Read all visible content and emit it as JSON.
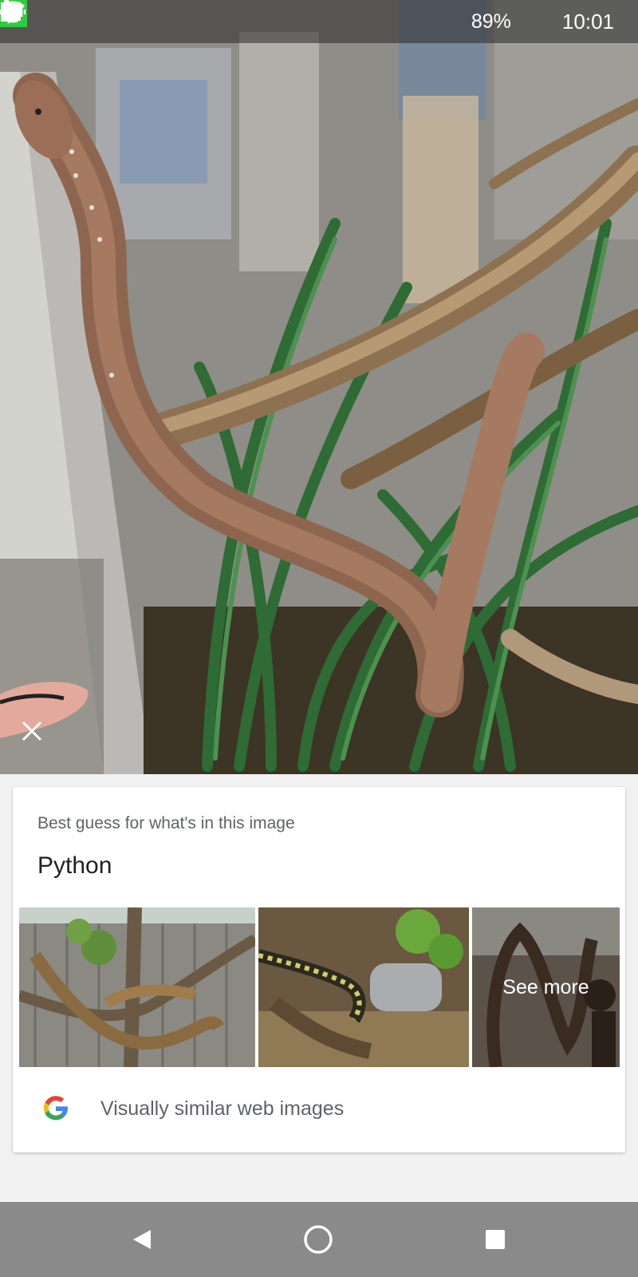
{
  "status_bar": {
    "battery_percent": "89%",
    "time": "10:01",
    "notification_icons": [
      "audio-wave-icon",
      "amazon-icon",
      "gmail-icon",
      "gallery-icon",
      "phone-app-icon"
    ],
    "system_icons": [
      "data-saver-icon",
      "bluetooth-icon",
      "vibrate-icon",
      "alarm-icon",
      "wifi-icon",
      "cell-signal-icon",
      "battery-icon"
    ]
  },
  "close_icon": "close-icon",
  "result_card": {
    "subtitle": "Best guess for what's in this image",
    "title": "Python",
    "thumbnails": [
      {
        "name": "python-in-tree-thumbnail"
      },
      {
        "name": "carpet-python-terrarium-thumbnail"
      },
      {
        "name": "python-outdoor-thumbnail",
        "overlay_label": "See more"
      }
    ],
    "similar_images_label": "Visually similar web images",
    "logo": "google-g-logo"
  },
  "nav_bar": {
    "icons": [
      "back-icon",
      "home-icon",
      "recents-icon"
    ]
  },
  "colors": {
    "google_blue": "#4285F4",
    "google_red": "#EA4335",
    "google_yellow": "#FBBC05",
    "google_green": "#34A853",
    "nav_bar": "#8a8a8a",
    "phone_app_green": "#2ecc40"
  }
}
